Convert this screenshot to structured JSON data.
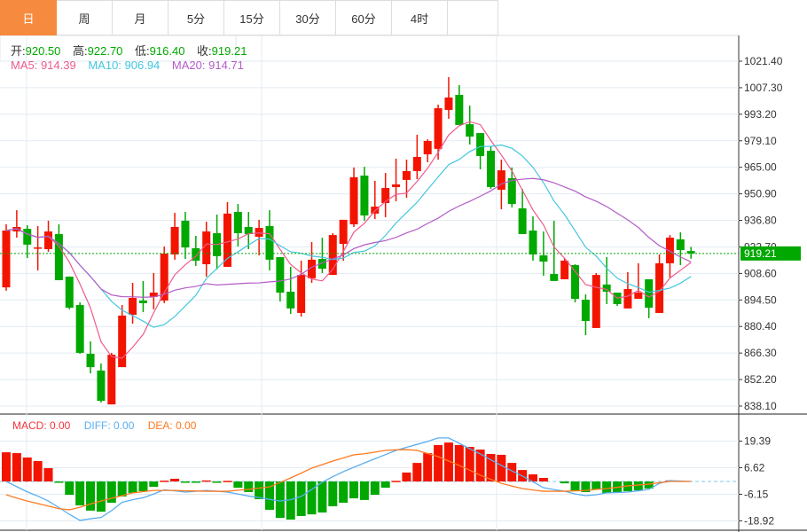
{
  "tabs": [
    "日",
    "周",
    "月",
    "5分",
    "15分",
    "30分",
    "60分",
    "4时"
  ],
  "active_tab": 0,
  "ohlc": {
    "open_label": "开:",
    "open": "920.50",
    "high_label": "高:",
    "high": "922.70",
    "low_label": "低:",
    "low": "916.40",
    "close_label": "收:",
    "close": "919.21"
  },
  "ma": {
    "ma5": "MA5: 914.39",
    "ma10": "MA10: 906.94",
    "ma20": "MA20: 914.71"
  },
  "macd_legend": {
    "macd": "MACD: 0.00",
    "diff": "DIFF: 0.00",
    "dea": "DEA: 0.00"
  },
  "current_price": "919.21",
  "colors": {
    "up": "#F31400",
    "down": "#00A800",
    "ma5": "#EE5A8E",
    "ma10": "#43C6DF",
    "ma20": "#B35CC8",
    "diff": "#5AAEF0",
    "dea": "#FF7A22",
    "active_tab": "#F68B3F"
  },
  "chart_data": [
    {
      "type": "candlestick",
      "title": "Daily K-line",
      "yticks": [
        "1021.40",
        "1007.30",
        "993.20",
        "979.10",
        "965.00",
        "950.90",
        "936.80",
        "922.70",
        "908.60",
        "894.50",
        "880.40",
        "866.30",
        "852.20",
        "838.10"
      ],
      "ylim": [
        838.1,
        1021.4
      ],
      "grid": true,
      "candles_ohlc": [
        [
          901.2,
          934.7,
          899.4,
          931.4
        ],
        [
          930.9,
          942.2,
          927.6,
          933.3
        ],
        [
          932.3,
          934.2,
          916.8,
          923.9
        ],
        [
          922.0,
          933.8,
          910.2,
          922.4
        ],
        [
          921.5,
          936.6,
          920.1,
          930.9
        ],
        [
          929.5,
          934.7,
          905.0,
          905.0
        ],
        [
          906.9,
          907.0,
          889.5,
          890.4
        ],
        [
          891.8,
          893.2,
          865.9,
          866.4
        ],
        [
          865.9,
          872.5,
          855.5,
          858.8
        ],
        [
          857.0,
          860.7,
          840.0,
          840.9
        ],
        [
          839.0,
          866.4,
          839.0,
          865.4
        ],
        [
          858.8,
          891.8,
          858.8,
          886.2
        ],
        [
          886.6,
          903.6,
          881.9,
          895.6
        ],
        [
          894.2,
          904.6,
          888.1,
          892.8
        ],
        [
          896.1,
          908.8,
          889.5,
          898.4
        ],
        [
          894.2,
          922.9,
          892.8,
          919.2
        ],
        [
          918.7,
          940.8,
          915.9,
          933.3
        ],
        [
          936.6,
          941.3,
          916.3,
          922.4
        ],
        [
          922.0,
          928.6,
          912.6,
          915.4
        ],
        [
          913.5,
          936.1,
          906.9,
          930.9
        ],
        [
          930.0,
          939.9,
          910.7,
          917.8
        ],
        [
          912.1,
          946.5,
          912.1,
          940.4
        ],
        [
          941.3,
          945.5,
          922.9,
          930.0
        ],
        [
          933.3,
          941.3,
          921.5,
          929.5
        ],
        [
          928.1,
          937.1,
          918.2,
          932.8
        ],
        [
          933.8,
          942.2,
          910.2,
          915.9
        ],
        [
          917.3,
          917.3,
          893.7,
          898.4
        ],
        [
          898.9,
          912.1,
          887.1,
          890.0
        ],
        [
          887.6,
          915.4,
          885.7,
          907.8
        ],
        [
          906.0,
          925.3,
          903.6,
          915.9
        ],
        [
          916.3,
          927.6,
          908.8,
          911.1
        ],
        [
          907.8,
          930.0,
          907.8,
          929.0
        ],
        [
          924.3,
          937.1,
          915.4,
          937.1
        ],
        [
          934.7,
          964.9,
          933.3,
          959.7
        ],
        [
          960.6,
          965.3,
          936.6,
          939.4
        ],
        [
          940.4,
          957.8,
          937.5,
          944.1
        ],
        [
          946.0,
          962.0,
          938.5,
          954.0
        ],
        [
          954.5,
          969.6,
          947.0,
          955.9
        ],
        [
          958.3,
          969.1,
          948.8,
          963.0
        ],
        [
          963.0,
          982.3,
          958.7,
          970.5
        ],
        [
          971.9,
          979.9,
          967.7,
          979.0
        ],
        [
          974.8,
          998.3,
          969.1,
          996.4
        ],
        [
          995.5,
          1012.9,
          990.8,
          1002.1
        ],
        [
          1003.5,
          1008.7,
          987.5,
          987.5
        ],
        [
          987.9,
          997.8,
          977.1,
          981.3
        ],
        [
          983.2,
          983.2,
          963.9,
          971.0
        ],
        [
          973.8,
          976.2,
          953.5,
          954.5
        ],
        [
          953.1,
          969.1,
          942.7,
          963.4
        ],
        [
          959.2,
          964.9,
          943.7,
          945.5
        ],
        [
          943.2,
          953.5,
          929.5,
          929.5
        ],
        [
          931.4,
          938.9,
          915.4,
          918.7
        ],
        [
          918.2,
          930.9,
          907.4,
          914.9
        ],
        [
          908.3,
          936.6,
          904.6,
          904.6
        ],
        [
          905.5,
          916.8,
          905.5,
          915.4
        ],
        [
          913.0,
          913.5,
          893.2,
          895.1
        ],
        [
          894.6,
          897.5,
          875.8,
          883.3
        ],
        [
          879.6,
          908.8,
          879.6,
          907.8
        ],
        [
          902.7,
          917.3,
          892.3,
          898.9
        ],
        [
          898.4,
          898.4,
          891.3,
          892.3
        ],
        [
          890.0,
          909.3,
          890.0,
          900.3
        ],
        [
          895.1,
          914.0,
          895.1,
          898.4
        ],
        [
          905.5,
          905.5,
          884.8,
          890.4
        ],
        [
          887.6,
          918.7,
          887.6,
          914.0
        ],
        [
          914.0,
          929.0,
          906.4,
          927.6
        ],
        [
          926.7,
          930.5,
          913.0,
          921.0
        ],
        [
          920.5,
          922.7,
          916.4,
          919.21
        ]
      ],
      "ma_periods": [
        5,
        10,
        20
      ],
      "current_price": 919.21
    },
    {
      "type": "bar",
      "title": "MACD",
      "yticks": [
        "19.39",
        "6.62",
        "-6.15",
        "-18.92"
      ],
      "ylim": [
        -18.92,
        19.39
      ],
      "macd_hist": [
        14.0,
        13.6,
        11.5,
        9.8,
        6.4,
        -0.4,
        -6.4,
        -11.5,
        -14.0,
        -14.5,
        -10.2,
        -7.2,
        -5.5,
        -4.7,
        -2.6,
        0.4,
        1.3,
        -0.3,
        -0.3,
        0.5,
        -0.3,
        0.3,
        -3.0,
        -5.1,
        -8.5,
        -13.6,
        -17.5,
        -18.3,
        -16.6,
        -15.8,
        -14.9,
        -11.9,
        -10.2,
        -8.1,
        -8.9,
        -6.4,
        -3.0,
        0.3,
        4.3,
        8.9,
        13.6,
        17.5,
        18.7,
        17.5,
        16.6,
        15.3,
        13.2,
        12.8,
        8.9,
        5.5,
        3.4,
        1.7,
        0,
        -0.9,
        -4.7,
        -5.1,
        -3.8,
        -5.5,
        -5.1,
        -4.7,
        -4.3,
        -3.4,
        0,
        0.5,
        0,
        0
      ],
      "diff": [
        0,
        -2.5,
        -5,
        -7,
        -9.4,
        -12.5,
        -15.8,
        -18.7,
        -17.9,
        -17.3,
        -14,
        -10,
        -8.8,
        -7.8,
        -6,
        -4,
        -4.5,
        -5.1,
        -4.7,
        -4.3,
        -4.7,
        -5.1,
        -6,
        -7,
        -7.7,
        -8.6,
        -9.4,
        -8.8,
        -7.2,
        -3.8,
        -0.4,
        2.3,
        4.7,
        6.8,
        8.9,
        10.9,
        12.9,
        14.9,
        16.4,
        17.8,
        19.2,
        20.9,
        20.9,
        18.3,
        15.7,
        13.2,
        10.4,
        7.7,
        5.1,
        2.6,
        -0.2,
        -3.0,
        -3.9,
        -4.7,
        -6.0,
        -6.8,
        -6.4,
        -5.5,
        -5.3,
        -5.1,
        -4.5,
        -3.8,
        -0.9,
        0.4,
        0.2,
        0
      ],
      "dea": [
        -6.4,
        -8,
        -9.4,
        -10.6,
        -11.8,
        -13.1,
        -13.6,
        -12.4,
        -10.8,
        -9.4,
        -8.1,
        -6.8,
        -5.5,
        -4.9,
        -4.3,
        -4.3,
        -4.3,
        -4.5,
        -4.6,
        -4.7,
        -4.7,
        -4.7,
        -4.2,
        -3.8,
        -3.2,
        -2.6,
        -0.5,
        1.7,
        4.0,
        6.4,
        8.1,
        9.8,
        11.3,
        12.8,
        13.3,
        14.1,
        14.9,
        15.2,
        15.3,
        14.9,
        13.4,
        11.9,
        9.8,
        7.7,
        5.4,
        3.0,
        1.0,
        -0.9,
        -2.2,
        -3.4,
        -4.1,
        -4.7,
        -4.7,
        -4.7,
        -4.5,
        -4.3,
        -3.8,
        -3.4,
        -2.8,
        -2.1,
        -1.7,
        -1.3,
        -0.6,
        0,
        0,
        0
      ]
    }
  ]
}
